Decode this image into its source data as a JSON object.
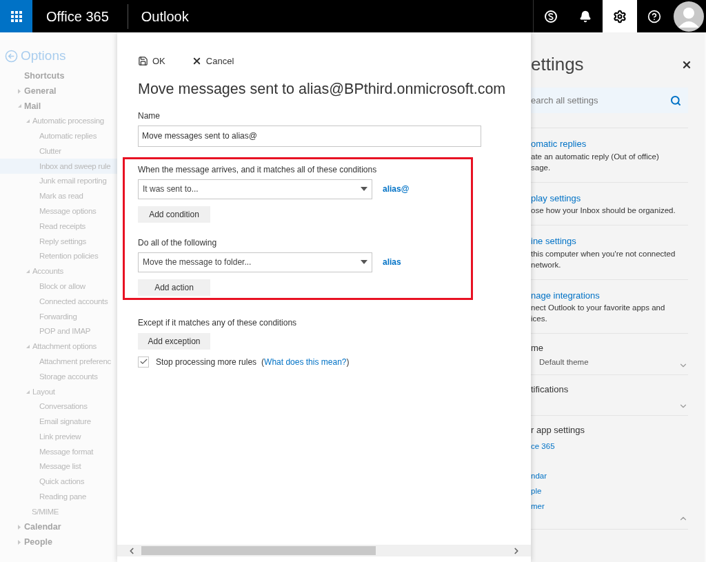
{
  "topbar": {
    "brand": "Office 365",
    "app": "Outlook",
    "icons": [
      {
        "kind": "skype",
        "selected": false
      },
      {
        "kind": "bell",
        "selected": false
      },
      {
        "kind": "gear",
        "selected": true
      },
      {
        "kind": "help",
        "selected": false
      },
      {
        "kind": "avatar",
        "selected": false
      }
    ]
  },
  "nav": {
    "title": "Options",
    "items": [
      {
        "kind": "link",
        "label": "Shortcuts",
        "selected": false
      },
      {
        "kind": "group",
        "label": "General",
        "expanded": false
      },
      {
        "kind": "group",
        "label": "Mail",
        "expanded": true,
        "children": [
          {
            "kind": "group",
            "label": "Automatic processing",
            "expanded": true,
            "children": [
              {
                "kind": "link",
                "label": "Automatic replies",
                "selected": false
              },
              {
                "kind": "link",
                "label": "Clutter",
                "selected": false
              },
              {
                "kind": "link",
                "label": "Inbox and sweep rule",
                "selected": true
              },
              {
                "kind": "link",
                "label": "Junk email reporting",
                "selected": false
              },
              {
                "kind": "link",
                "label": "Mark as read",
                "selected": false
              },
              {
                "kind": "link",
                "label": "Message options",
                "selected": false
              },
              {
                "kind": "link",
                "label": "Read receipts",
                "selected": false
              },
              {
                "kind": "link",
                "label": "Reply settings",
                "selected": false
              },
              {
                "kind": "link",
                "label": "Retention policies",
                "selected": false
              }
            ]
          },
          {
            "kind": "group",
            "label": "Accounts",
            "expanded": true,
            "children": [
              {
                "kind": "link",
                "label": "Block or allow",
                "selected": false
              },
              {
                "kind": "link",
                "label": "Connected accounts",
                "selected": false
              },
              {
                "kind": "link",
                "label": "Forwarding",
                "selected": false
              },
              {
                "kind": "link",
                "label": "POP and IMAP",
                "selected": false
              }
            ]
          },
          {
            "kind": "group",
            "label": "Attachment options",
            "expanded": true,
            "children": [
              {
                "kind": "link",
                "label": "Attachment preferenc",
                "selected": false
              },
              {
                "kind": "link",
                "label": "Storage accounts",
                "selected": false
              }
            ]
          },
          {
            "kind": "group",
            "label": "Layout",
            "expanded": true,
            "children": [
              {
                "kind": "link",
                "label": "Conversations",
                "selected": false
              },
              {
                "kind": "link",
                "label": "Email signature",
                "selected": false
              },
              {
                "kind": "link",
                "label": "Link preview",
                "selected": false
              },
              {
                "kind": "link",
                "label": "Message format",
                "selected": false
              },
              {
                "kind": "link",
                "label": "Message list",
                "selected": false
              },
              {
                "kind": "link",
                "label": "Quick actions",
                "selected": false
              },
              {
                "kind": "link",
                "label": "Reading pane",
                "selected": false
              }
            ]
          },
          {
            "kind": "link",
            "label": "S/MIME",
            "selected": false
          }
        ]
      },
      {
        "kind": "group",
        "label": "Calendar",
        "expanded": false
      },
      {
        "kind": "group",
        "label": "People",
        "expanded": false
      }
    ]
  },
  "rule": {
    "ok": "OK",
    "cancel": "Cancel",
    "title": "Move messages sent to alias@BPthird.onmicrosoft.com",
    "name_label": "Name",
    "name_value": "Move messages sent to alias@",
    "conditions": {
      "label": "When the message arrives, and it matches all of these conditions",
      "select": "It was sent to...",
      "value": "alias@",
      "button": "Add condition"
    },
    "actions": {
      "label": "Do all of the following",
      "select": "Move the message to folder...",
      "value": "alias",
      "button": "Add action"
    },
    "exceptions": {
      "label": "Except if it matches any of these conditions",
      "button": "Add exception"
    },
    "stop": {
      "label": "Stop processing more rules",
      "checked": true,
      "open": "(",
      "link": "What does this mean?",
      "close": ")"
    }
  },
  "settings": {
    "title": "ettings",
    "search": {
      "placeholder": "earch all settings"
    },
    "sections": [
      {
        "kind": "link",
        "title": "omatic replies",
        "lines": [
          "ate an automatic reply (Out of office)",
          "sage."
        ]
      },
      {
        "kind": "link",
        "title": "play settings",
        "lines": [
          "ose how your Inbox should be organized."
        ]
      },
      {
        "kind": "link",
        "title": "ine settings",
        "lines": [
          "this computer when you're not connected",
          "network."
        ]
      },
      {
        "kind": "link",
        "title": "nage integrations",
        "lines": [
          "nect Outlook to your favorite apps and",
          "ices."
        ]
      },
      {
        "kind": "dropdown",
        "title": "me",
        "value": "Default theme",
        "expanded": false
      },
      {
        "kind": "dropdown",
        "title": "tifications",
        "expanded": false
      },
      {
        "kind": "list",
        "title": "r app settings",
        "expanded": true,
        "links": [
          "ce 365",
          "ndar",
          "ple",
          "mer"
        ]
      }
    ]
  }
}
